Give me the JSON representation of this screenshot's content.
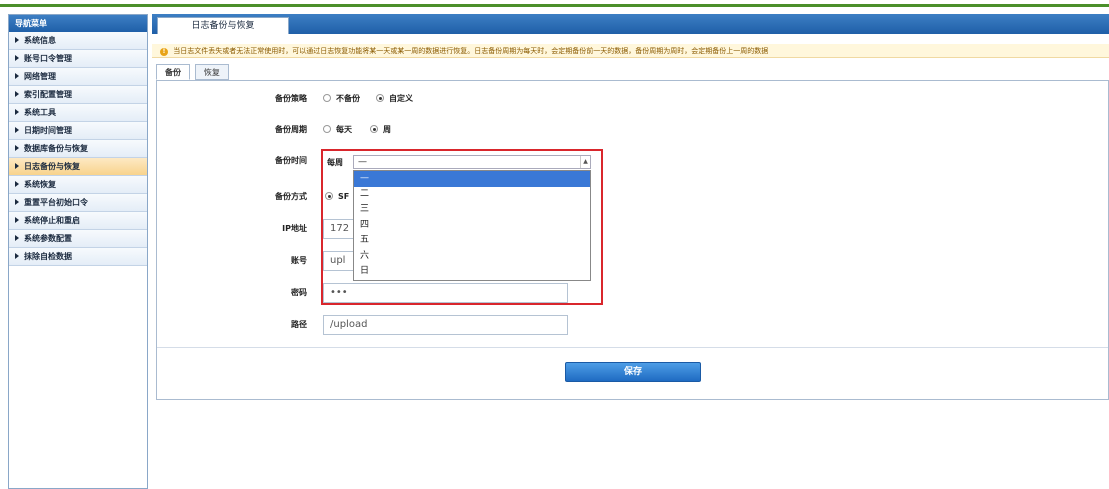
{
  "sidebar": {
    "title": "导航菜单",
    "items": [
      {
        "label": "系统信息"
      },
      {
        "label": "账号口令管理"
      },
      {
        "label": "网络管理"
      },
      {
        "label": "索引配置管理"
      },
      {
        "label": "系统工具"
      },
      {
        "label": "日期时间管理"
      },
      {
        "label": "数据库备份与恢复"
      },
      {
        "label": "日志备份与恢复"
      },
      {
        "label": "系统恢复"
      },
      {
        "label": "重置平台初始口令"
      },
      {
        "label": "系统停止和重启"
      },
      {
        "label": "系统参数配置"
      },
      {
        "label": "抹除自检数据"
      }
    ],
    "active_index": 7
  },
  "main": {
    "tab_title": "日志备份与恢复",
    "notice": "当日志文件丢失或者无法正常使用时，可以通过日志恢复功能将某一天或某一周的数据进行恢复。日志备份周期为每天时，会定期备份前一天的数据，备份周期为周时，会定期备份上一周的数据",
    "subtabs": [
      "备份",
      "恢复"
    ],
    "form": {
      "strategy_label": "备份策略",
      "strategy_options": [
        "不备份",
        "自定义"
      ],
      "strategy_selected": 1,
      "cycle_label": "备份周期",
      "cycle_options": [
        "每天",
        "周"
      ],
      "cycle_selected": 1,
      "time_label": "备份时间",
      "time_prefix": "每周",
      "time_value": "—",
      "time_options": [
        "—",
        "二",
        "三",
        "四",
        "五",
        "六",
        "日"
      ],
      "time_option_selected": 0,
      "method_label": "备份方式",
      "method_value": "SF",
      "ip_label": "IP地址",
      "ip_value": "172",
      "account_label": "账号",
      "account_value": "upl",
      "password_label": "密码",
      "password_value": "•••",
      "path_label": "路径",
      "path_value": "/upload"
    },
    "save_label": "保存"
  },
  "colors": {
    "header_blue": "#1f5fa8",
    "active_item": "#f8d38c",
    "highlight_red": "#d9262c",
    "dropdown_selected": "#3a78d6"
  }
}
